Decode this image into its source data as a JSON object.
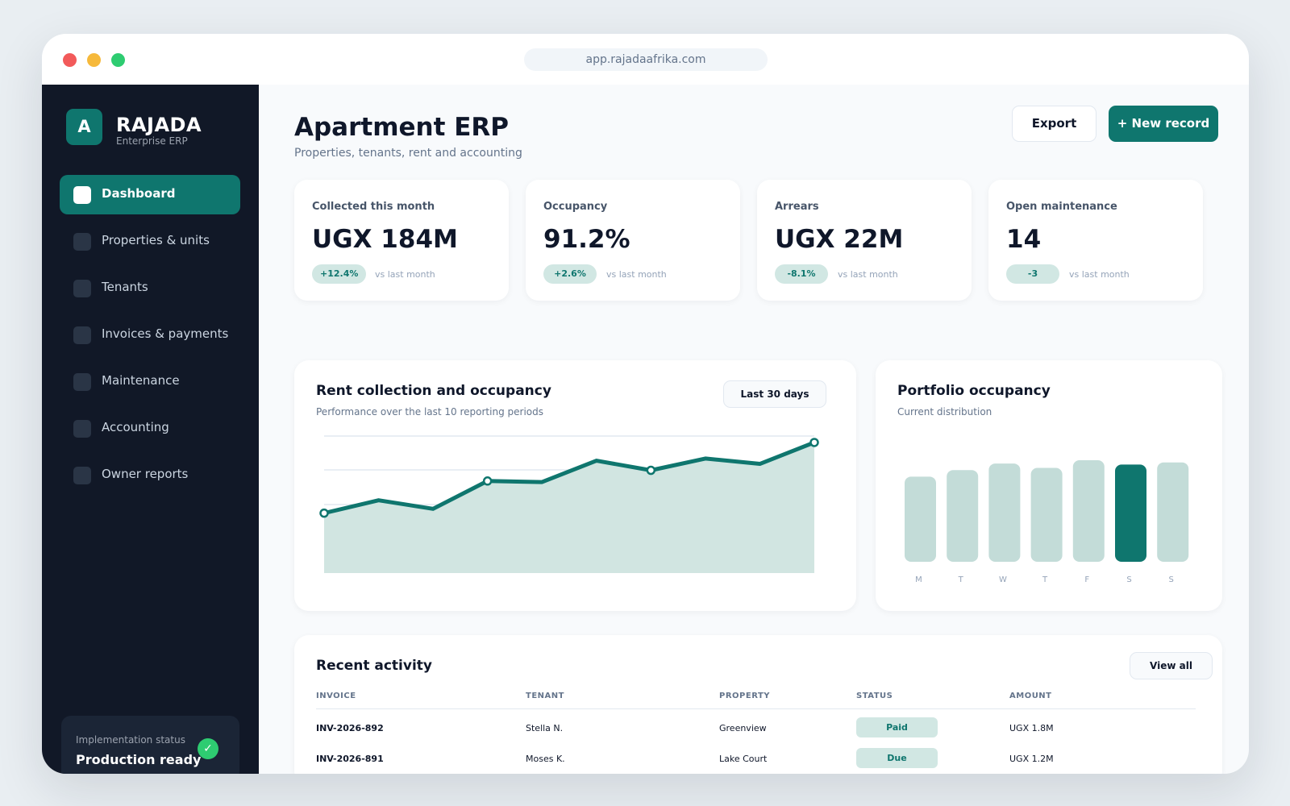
{
  "browser": {
    "url": "app.rajadaafrika.com"
  },
  "sidebar": {
    "logo_letter": "A",
    "brand": "RAJADA",
    "brand_sub": "Enterprise ERP",
    "items": [
      {
        "label": "Dashboard",
        "active": true
      },
      {
        "label": "Properties & units"
      },
      {
        "label": "Tenants"
      },
      {
        "label": "Invoices & payments"
      },
      {
        "label": "Maintenance"
      },
      {
        "label": "Accounting"
      },
      {
        "label": "Owner reports"
      }
    ],
    "status": {
      "label": "Implementation status",
      "value": "Production ready",
      "icon": "✓"
    }
  },
  "header": {
    "title": "Apartment ERP",
    "subtitle": "Properties, tenants, rent and accounting",
    "export_label": "Export",
    "new_label": "+ New record"
  },
  "kpis": [
    {
      "label": "Collected this month",
      "value": "UGX 184M",
      "delta": "+12.4%",
      "vs": "vs last month"
    },
    {
      "label": "Occupancy",
      "value": "91.2%",
      "delta": "+2.6%",
      "vs": "vs last month"
    },
    {
      "label": "Arrears",
      "value": "UGX 22M",
      "delta": "-8.1%",
      "vs": "vs last month"
    },
    {
      "label": "Open maintenance",
      "value": "14",
      "delta": "-3",
      "vs": "vs last month"
    }
  ],
  "rent_panel": {
    "title": "Rent collection and occupancy",
    "subtitle": "Performance over the last 10 reporting periods",
    "range_label": "Last 30 days"
  },
  "occupancy_panel": {
    "title": "Portfolio occupancy",
    "subtitle": "Current distribution"
  },
  "chart_data": [
    {
      "type": "area",
      "x": [
        1,
        2,
        3,
        4,
        5,
        6,
        7,
        8,
        9,
        10
      ],
      "values": [
        28,
        40,
        32,
        58,
        57,
        77,
        68,
        79,
        74,
        94
      ],
      "ylim": [
        -28,
        100
      ],
      "grid": true,
      "color": "#0f766e",
      "fill": "#d1e5e1",
      "markers_at": [
        0,
        3,
        6,
        9
      ]
    },
    {
      "type": "bar",
      "categories": [
        "M",
        "T",
        "W",
        "T",
        "F",
        "S",
        "S"
      ],
      "values": [
        78,
        84,
        90,
        86,
        93,
        89,
        91
      ],
      "ylim": [
        0,
        93
      ],
      "highlight_index": 5,
      "color": "#c3dcd8",
      "highlight_color": "#0f766e"
    }
  ],
  "activity": {
    "title": "Recent activity",
    "view_all": "View all",
    "columns": [
      "INVOICE",
      "TENANT",
      "PROPERTY",
      "STATUS",
      "AMOUNT"
    ],
    "rows": [
      [
        "INV-2026-892",
        "Stella N.",
        "Greenview",
        "Paid",
        "UGX 1.8M"
      ],
      [
        "INV-2026-891",
        "Moses K.",
        "Lake Court",
        "Due",
        "UGX 1.2M"
      ]
    ]
  }
}
